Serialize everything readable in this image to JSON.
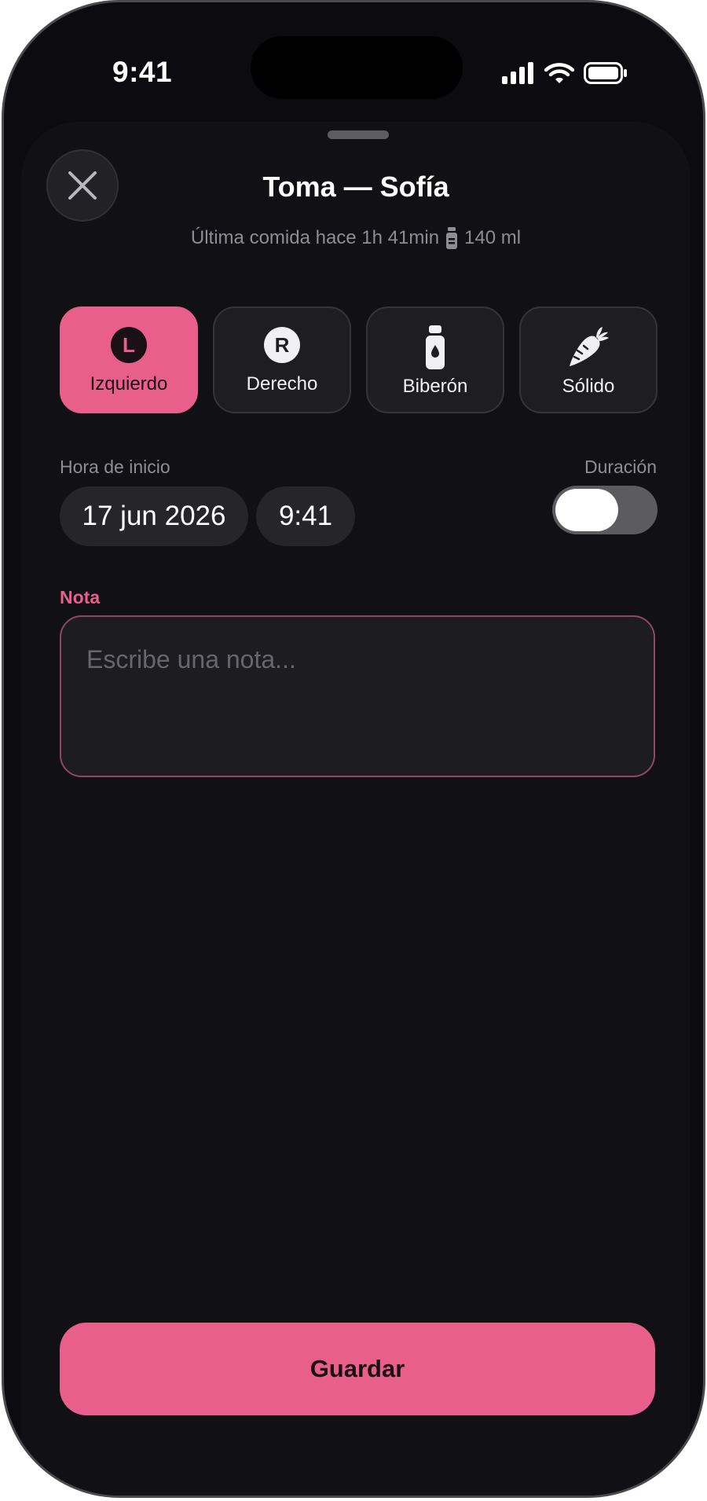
{
  "status_bar": {
    "time": "9:41"
  },
  "sheet": {
    "title": "Toma — Sofía",
    "subtitle": {
      "prefix": "Última comida hace 1h 41min",
      "amount": "140 ml",
      "icon": "bottle-icon"
    },
    "close_icon": "close-icon"
  },
  "feeding_types": [
    {
      "label": "Izquierdo",
      "badge": "L",
      "active": true
    },
    {
      "label": "Derecho",
      "badge": "R",
      "active": false
    },
    {
      "label": "Biberón",
      "icon": "bottle-icon",
      "active": false
    },
    {
      "label": "Sólido",
      "icon": "carrot-icon",
      "active": false
    }
  ],
  "start_time": {
    "label": "Hora de inicio",
    "date": "17 jun 2026",
    "time": "9:41"
  },
  "duration": {
    "label": "Duración",
    "enabled": false
  },
  "note": {
    "label": "Nota",
    "placeholder": "Escribe una nota..."
  },
  "save_button": {
    "label": "Guardar"
  },
  "colors": {
    "accent": "#e95f8b",
    "background": "#111015",
    "surface": "#1e1d22"
  }
}
